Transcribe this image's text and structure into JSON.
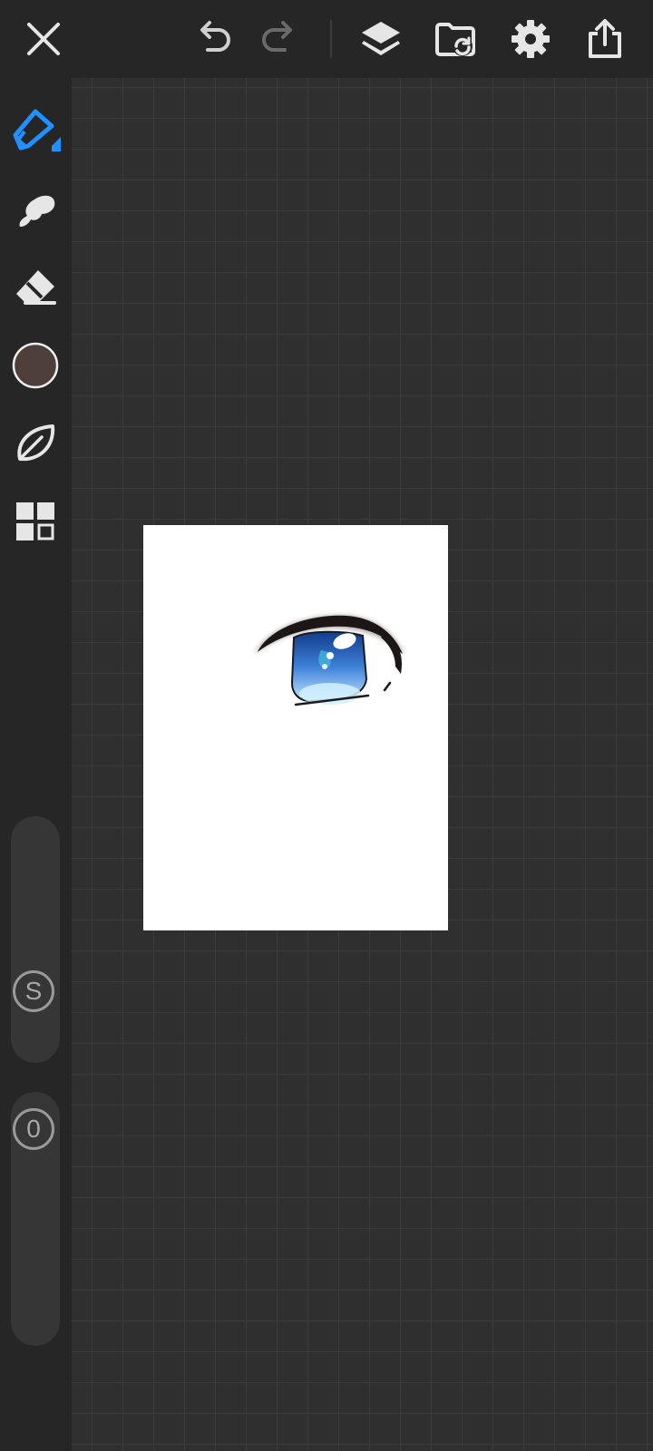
{
  "toolbar": {
    "close_icon": "close-icon",
    "undo_icon": "undo-icon",
    "redo_icon": "redo-icon",
    "layers_icon": "layers-icon",
    "gallery_icon": "folder-refresh-icon",
    "settings_icon": "gear-icon",
    "export_icon": "share-icon"
  },
  "sidebar": {
    "tools": [
      {
        "name": "brush",
        "icon": "pen-nib-icon",
        "active": true
      },
      {
        "name": "smudge",
        "icon": "smudge-icon",
        "active": false
      },
      {
        "name": "eraser",
        "icon": "eraser-icon",
        "active": false
      },
      {
        "name": "color",
        "icon": "color-swatch",
        "active": false
      },
      {
        "name": "brush-library",
        "icon": "leaf-icon",
        "active": false
      },
      {
        "name": "more",
        "icon": "grid-icon",
        "active": false
      }
    ],
    "current_color": "#4e3f3b",
    "size_label": "S",
    "opacity_label": "0"
  },
  "colors": {
    "accent": "#1e90ff",
    "icon": "#e6e6e6",
    "disabled_icon": "#6a6a6a"
  }
}
